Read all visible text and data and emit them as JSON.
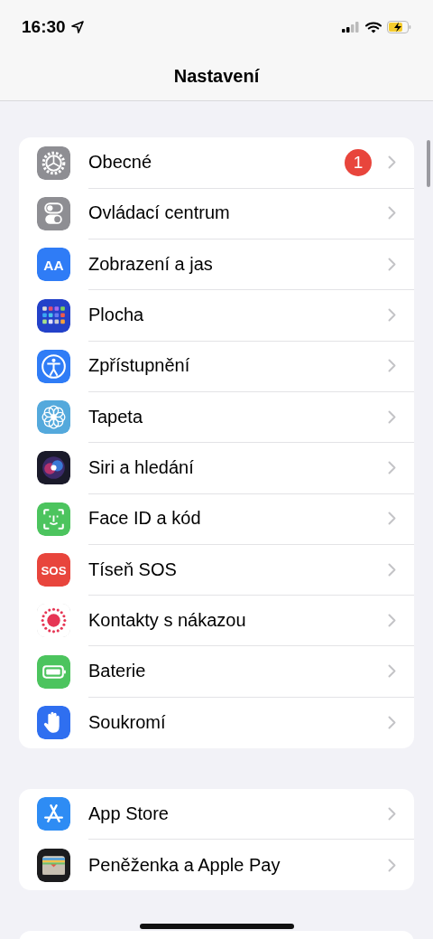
{
  "status_bar": {
    "time": "16:30"
  },
  "nav": {
    "title": "Nastavení"
  },
  "groups": [
    {
      "items": [
        {
          "label": "Obecné",
          "badge": "1"
        },
        {
          "label": "Ovládací centrum"
        },
        {
          "label": "Zobrazení a jas",
          "icon_label": "AA"
        },
        {
          "label": "Plocha"
        },
        {
          "label": "Zpřístupnění"
        },
        {
          "label": "Tapeta"
        },
        {
          "label": "Siri a hledání"
        },
        {
          "label": "Face ID a kód"
        },
        {
          "label": "Tíseň SOS",
          "icon_label": "SOS"
        },
        {
          "label": "Kontakty s nákazou"
        },
        {
          "label": "Baterie"
        },
        {
          "label": "Soukromí"
        }
      ]
    },
    {
      "items": [
        {
          "label": "App Store"
        },
        {
          "label": "Peněženka a Apple Pay"
        }
      ]
    }
  ]
}
